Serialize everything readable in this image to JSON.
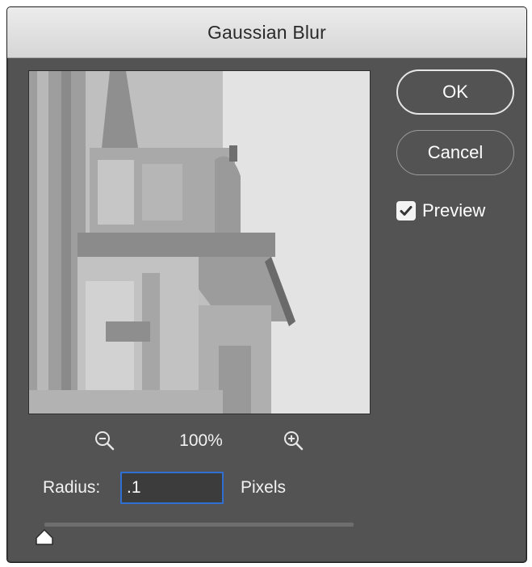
{
  "dialog": {
    "title": "Gaussian Blur"
  },
  "buttons": {
    "ok_label": "OK",
    "cancel_label": "Cancel"
  },
  "preview_option": {
    "label": "Preview",
    "checked": true
  },
  "zoom": {
    "level": "100%",
    "zoom_out_icon": "zoom-out-icon",
    "zoom_in_icon": "zoom-in-icon"
  },
  "radius": {
    "label": "Radius:",
    "value": ".1",
    "units": "Pixels"
  },
  "slider": {
    "value_fraction": 0.0
  },
  "colors": {
    "dialog_bg": "#535353",
    "focus_ring": "#2f6fd1",
    "text": "#f2f2f2"
  }
}
